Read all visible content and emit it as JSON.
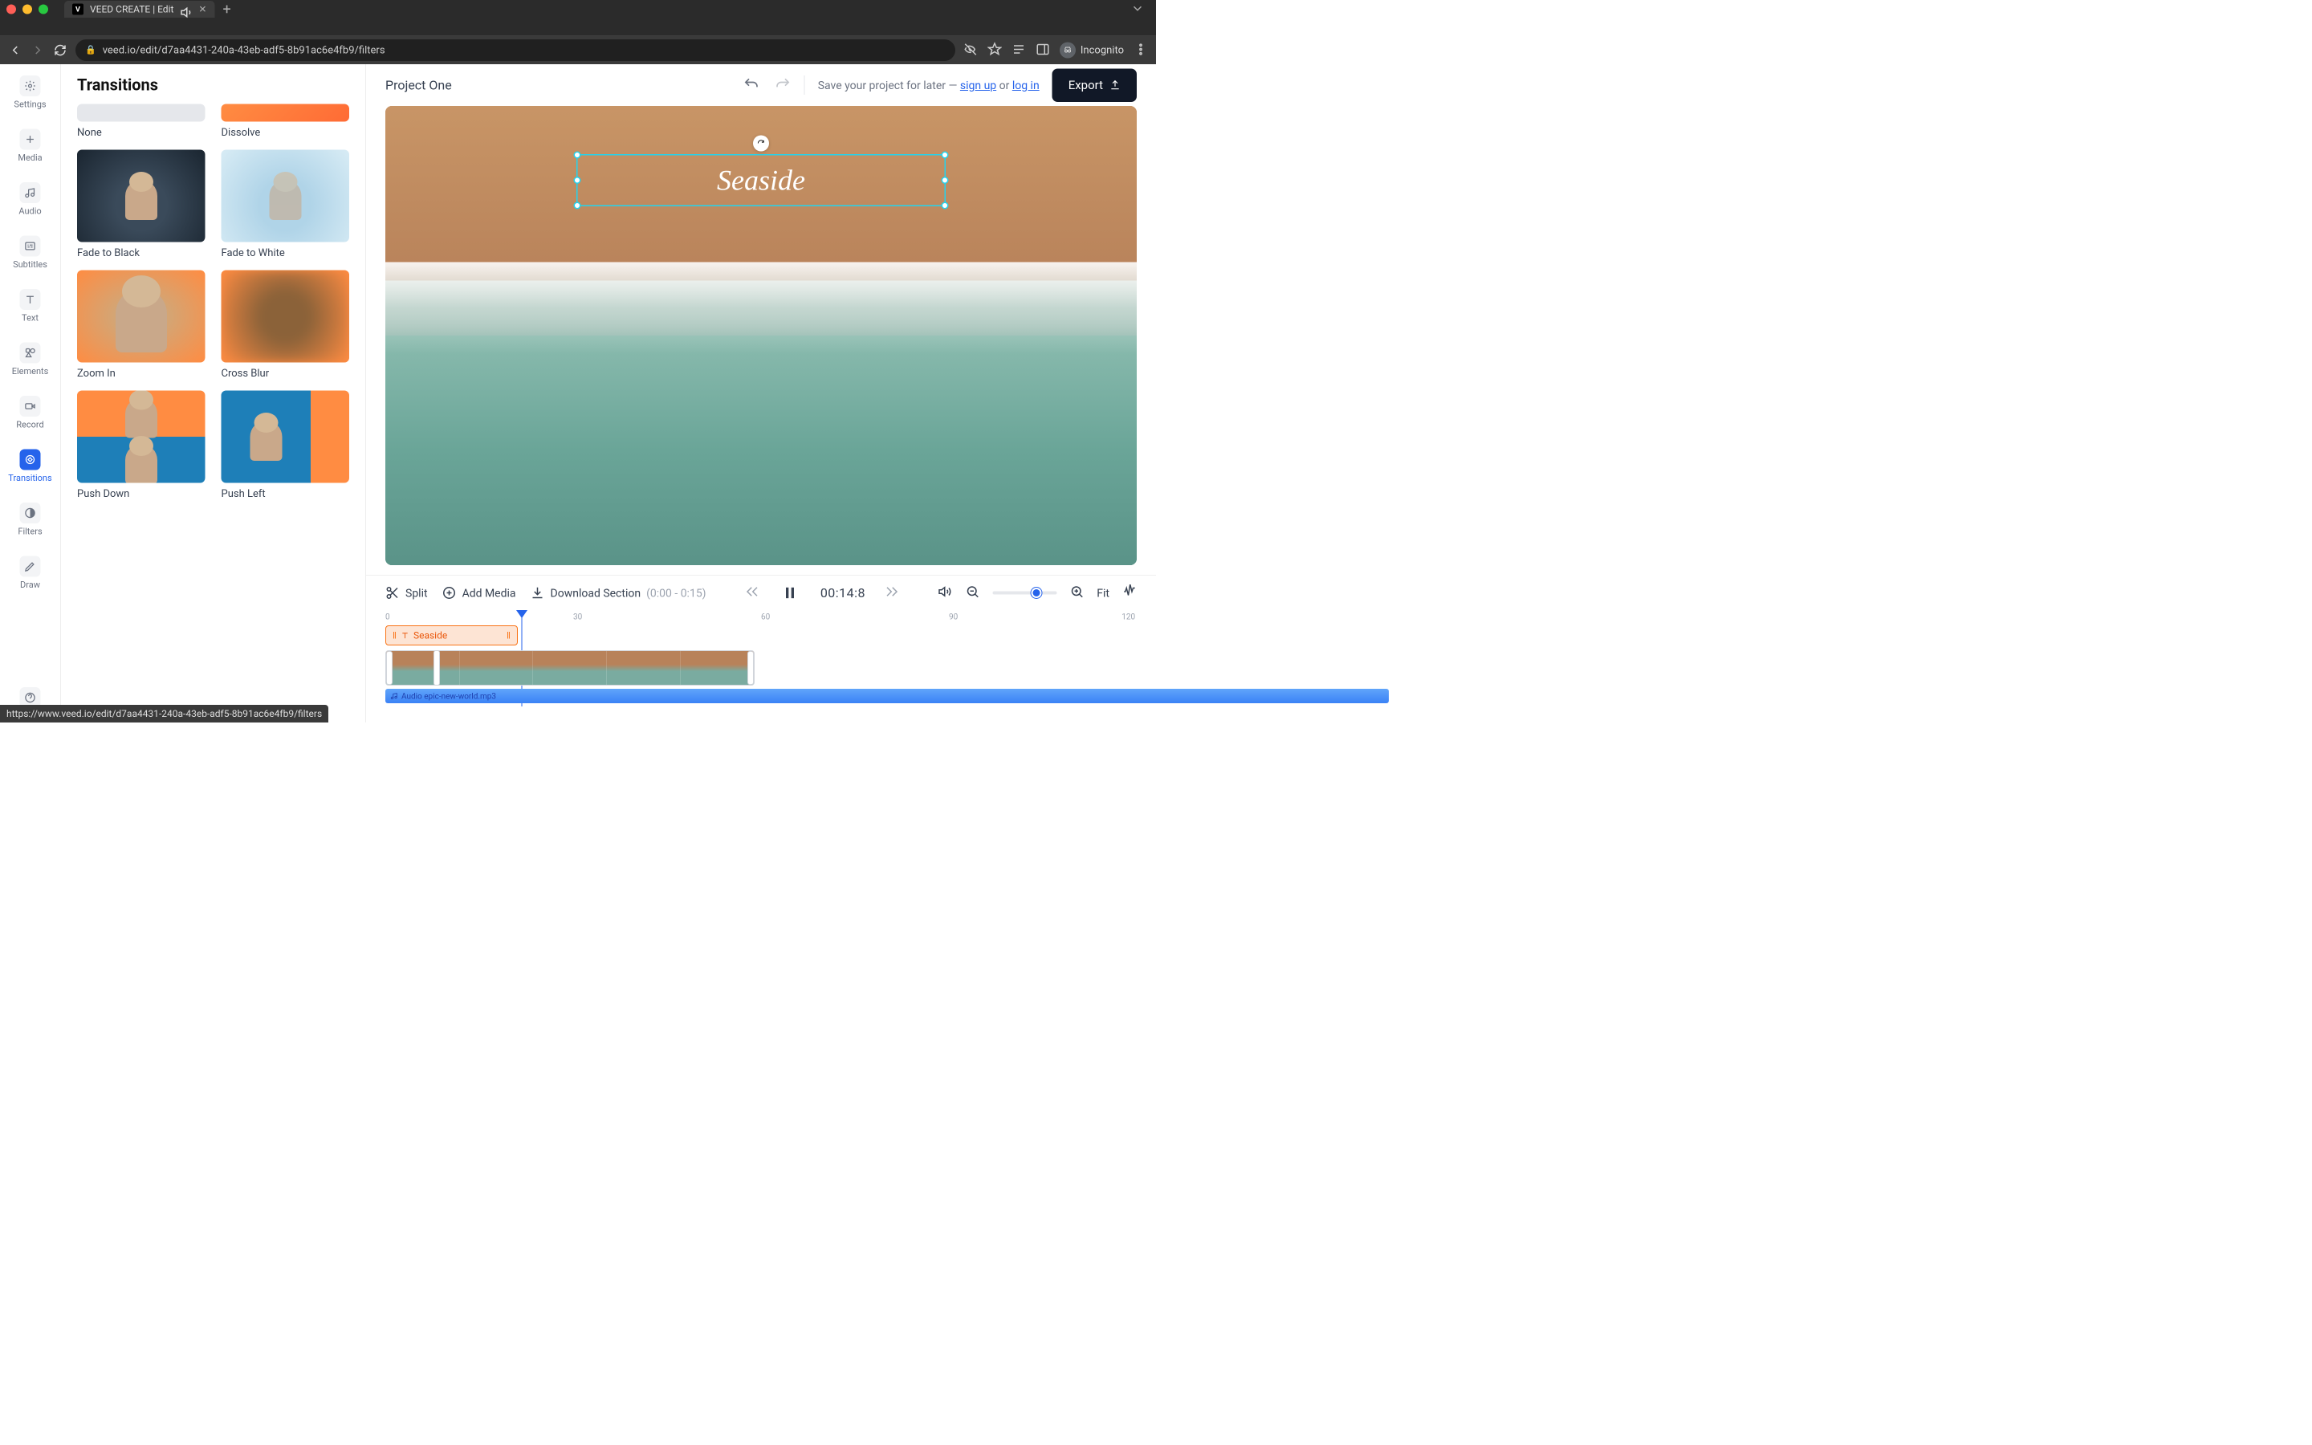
{
  "browser": {
    "tab_title": "VEED CREATE | Edit",
    "url": "veed.io/edit/d7aa4431-240a-43eb-adf5-8b91ac6e4fb9/filters",
    "incognito_label": "Incognito"
  },
  "rail": {
    "items": [
      {
        "label": "Settings",
        "icon": "gear-icon"
      },
      {
        "label": "Media",
        "icon": "plus-icon"
      },
      {
        "label": "Audio",
        "icon": "audio-icon"
      },
      {
        "label": "Subtitles",
        "icon": "subtitles-icon"
      },
      {
        "label": "Text",
        "icon": "text-icon"
      },
      {
        "label": "Elements",
        "icon": "elements-icon"
      },
      {
        "label": "Record",
        "icon": "record-icon"
      },
      {
        "label": "Transitions",
        "icon": "transitions-icon",
        "active": true
      },
      {
        "label": "Filters",
        "icon": "filters-icon"
      },
      {
        "label": "Draw",
        "icon": "draw-icon"
      }
    ]
  },
  "panel": {
    "title": "Transitions",
    "items": [
      {
        "label": "None",
        "variant": "none"
      },
      {
        "label": "Dissolve",
        "variant": "dissolve"
      },
      {
        "label": "Fade to Black",
        "variant": "fadeblack"
      },
      {
        "label": "Fade to White",
        "variant": "fadewhite"
      },
      {
        "label": "Zoom In",
        "variant": "zoomin"
      },
      {
        "label": "Cross Blur",
        "variant": "crossblur"
      },
      {
        "label": "Push Down",
        "variant": "pushdown"
      },
      {
        "label": "Push Left",
        "variant": "pushleft"
      }
    ]
  },
  "topbar": {
    "project_name": "Project One",
    "save_prefix": "Save your project for later — ",
    "signup": "sign up",
    "or": " or ",
    "login": "log in",
    "export": "Export"
  },
  "canvas": {
    "overlay_text": "Seaside"
  },
  "tl_toolbar": {
    "split": "Split",
    "add_media": "Add Media",
    "download_section": "Download Section",
    "range": "(0:00 - 0:15)",
    "timecode": "00:14:8",
    "fit": "Fit"
  },
  "timeline": {
    "ruler": [
      "0",
      "30",
      "60",
      "90",
      "120"
    ],
    "text_clip_label": "Seaside",
    "audio_clip_label": "Audio epic-new-world.mp3"
  },
  "status_url": "https://www.veed.io/edit/d7aa4431-240a-43eb-adf5-8b91ac6e4fb9/filters"
}
